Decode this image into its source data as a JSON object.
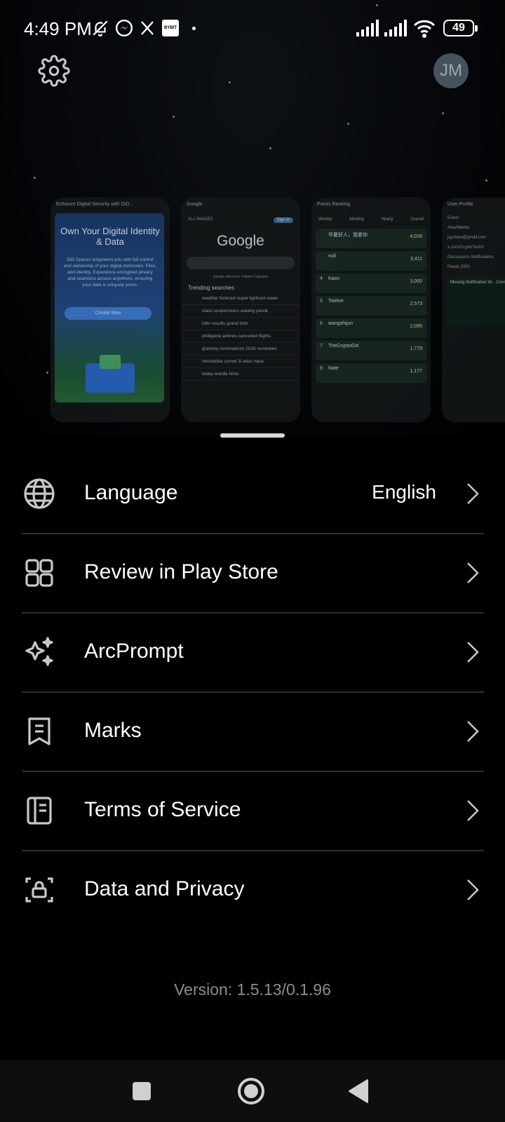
{
  "status_bar": {
    "time": "4:49 PM",
    "notification_icons": [
      "bell-off-icon",
      "messenger-icon",
      "x-icon",
      "bybit-icon",
      "dot-icon"
    ],
    "bybit_label": "BYBIT",
    "battery": "49"
  },
  "header": {
    "settings_icon": "gear-icon",
    "avatar_initials": "JM"
  },
  "carousel": {
    "cards": [
      {
        "header": "Enhance Digital Security with DiD...",
        "title": "Own Your Digital Identity & Data",
        "body": "DiD Spaces empowers you with full control and ownership of your digital memories. Files, and identity. Experience encrypted privacy and seamless access anywhere, ensuring your data is uniquely yours.",
        "button": "Create Now"
      },
      {
        "header": "Google",
        "tabs": "ALL   IMAGES",
        "sign_in": "Sign in",
        "logo": "Google",
        "offered_in": "Google offered in: Filipino  Cebuano",
        "trending_title": "Trending searches",
        "trending": [
          "weather forecast super typhoon uwan",
          "class suspensions walang pasok",
          "lotto results grand lotto",
          "philippine airlines cancelled flights",
          "grammy nominations 2026 nominees",
          "interstellar comet 3i atlas nasa",
          "today wordle hints"
        ]
      },
      {
        "header": "Points Ranking",
        "tabs": [
          "Weekly",
          "Monthly",
          "Yearly",
          "Overall"
        ],
        "rows": [
          {
            "rank": "",
            "name": "华夏好人，我爱你",
            "points": "4,028"
          },
          {
            "rank": "",
            "name": "null",
            "points": "3,411"
          },
          {
            "rank": "4",
            "name": "Kaos",
            "points": "3,000"
          },
          {
            "rank": "5",
            "name": "Twelve",
            "points": "2,573"
          },
          {
            "rank": "6",
            "name": "wangshijun",
            "points": "2,095"
          },
          {
            "rank": "7",
            "name": "TheCryptoGirl",
            "points": "1,779"
          },
          {
            "rank": "8",
            "name": "Nate",
            "points": "1,177"
          }
        ]
      },
      {
        "header": "User Profile",
        "name": "Guest",
        "location": "Asia/Manila",
        "email": "jaychiex@gmail.com",
        "link": "x.com/CryptoTestnt",
        "tab": "Discussions",
        "tab2": "Notifications",
        "feeds": "Feeds (550)",
        "post": "Missing Notification W... Connection Restores A..."
      }
    ]
  },
  "menu": {
    "items": [
      {
        "label": "Language",
        "value": "English",
        "icon": "globe-icon"
      },
      {
        "label": "Review in Play Store",
        "value": "",
        "icon": "apps-grid-icon"
      },
      {
        "label": "ArcPrompt",
        "value": "",
        "icon": "sparkles-icon"
      },
      {
        "label": "Marks",
        "value": "",
        "icon": "bookmark-icon"
      },
      {
        "label": "Terms of Service",
        "value": "",
        "icon": "book-icon"
      },
      {
        "label": "Data and Privacy",
        "value": "",
        "icon": "privacy-lock-icon"
      }
    ]
  },
  "version": "Version: 1.5.13/0.1.96",
  "nav_bar": {
    "buttons": [
      "recents-button",
      "home-button",
      "back-button"
    ]
  }
}
